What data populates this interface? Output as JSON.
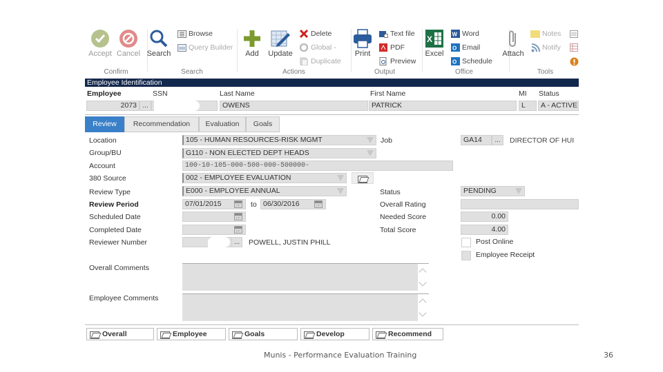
{
  "ribbon": {
    "groups": {
      "confirm": "Confirm",
      "search": "Search",
      "actions": "Actions",
      "output": "Output",
      "office": "Office",
      "tools": "Tools"
    },
    "accept": "Accept",
    "cancel": "Cancel",
    "search": "Search",
    "browse": "Browse",
    "query_builder": "Query Builder",
    "add": "Add",
    "update": "Update",
    "delete": "Delete",
    "global": "Global",
    "duplicate": "Duplicate",
    "print": "Print",
    "text_file": "Text file",
    "pdf": "PDF",
    "preview": "Preview",
    "excel": "Excel",
    "word": "Word",
    "email": "Email",
    "schedule": "Schedule",
    "attach": "Attach",
    "notes": "Notes",
    "notify": "Notify"
  },
  "employee_identification": {
    "title": "Employee Identification",
    "labels": {
      "employee": "Employee",
      "ssn": "SSN",
      "last_name": "Last Name",
      "first_name": "First Name",
      "mi": "MI",
      "status": "Status"
    },
    "values": {
      "employee": "2073",
      "ssn": "",
      "last_name": "OWENS",
      "first_name": "PATRICK",
      "mi": "L",
      "status": "A - ACTIVE"
    },
    "lookup": "..."
  },
  "tabs": [
    {
      "label": "Review",
      "active": true
    },
    {
      "label": "Recommendation",
      "active": false
    },
    {
      "label": "Evaluation",
      "active": false
    },
    {
      "label": "Goals",
      "active": false
    }
  ],
  "review": {
    "labels": {
      "location": "Location",
      "group_bu": "Group/BU",
      "account": "Account",
      "source_380": "380 Source",
      "review_type": "Review Type",
      "review_period": "Review Period",
      "scheduled_date": "Scheduled Date",
      "completed_date": "Completed Date",
      "reviewer_number": "Reviewer Number",
      "job": "Job",
      "status": "Status",
      "overall_rating": "Overall Rating",
      "needed_score": "Needed Score",
      "total_score": "Total Score",
      "post_online": "Post Online",
      "employee_receipt": "Employee Receipt",
      "overall_comments": "Overall Comments",
      "employee_comments": "Employee Comments",
      "to": "to"
    },
    "values": {
      "location": "105 - HUMAN RESOURCES-RISK MGMT",
      "group_bu": "G110 - NON ELECTED DEPT HEADS",
      "account": "100-10-105-000-500-000-500000-",
      "source_380": "002 - EMPLOYEE EVALUATION",
      "review_type": "E000 - EMPLOYEE ANNUAL",
      "review_period_from": "07/01/2015",
      "review_period_to": "06/30/2016",
      "scheduled_date": "",
      "completed_date": "",
      "reviewer_number": "",
      "reviewer_name": "POWELL, JUSTIN PHILL",
      "job_code": "GA14",
      "job_title": "DIRECTOR OF HUI",
      "status": "PENDING",
      "overall_rating": "",
      "needed_score": "0.00",
      "total_score": "4.00",
      "post_online": false,
      "employee_receipt": false,
      "overall_comments": "",
      "employee_comments": ""
    }
  },
  "bottom_buttons": [
    "Overall",
    "Employee",
    "Goals",
    "Develop",
    "Recommend"
  ],
  "footer": {
    "text": "Munis - Performance Evaluation Training",
    "page": "36"
  }
}
